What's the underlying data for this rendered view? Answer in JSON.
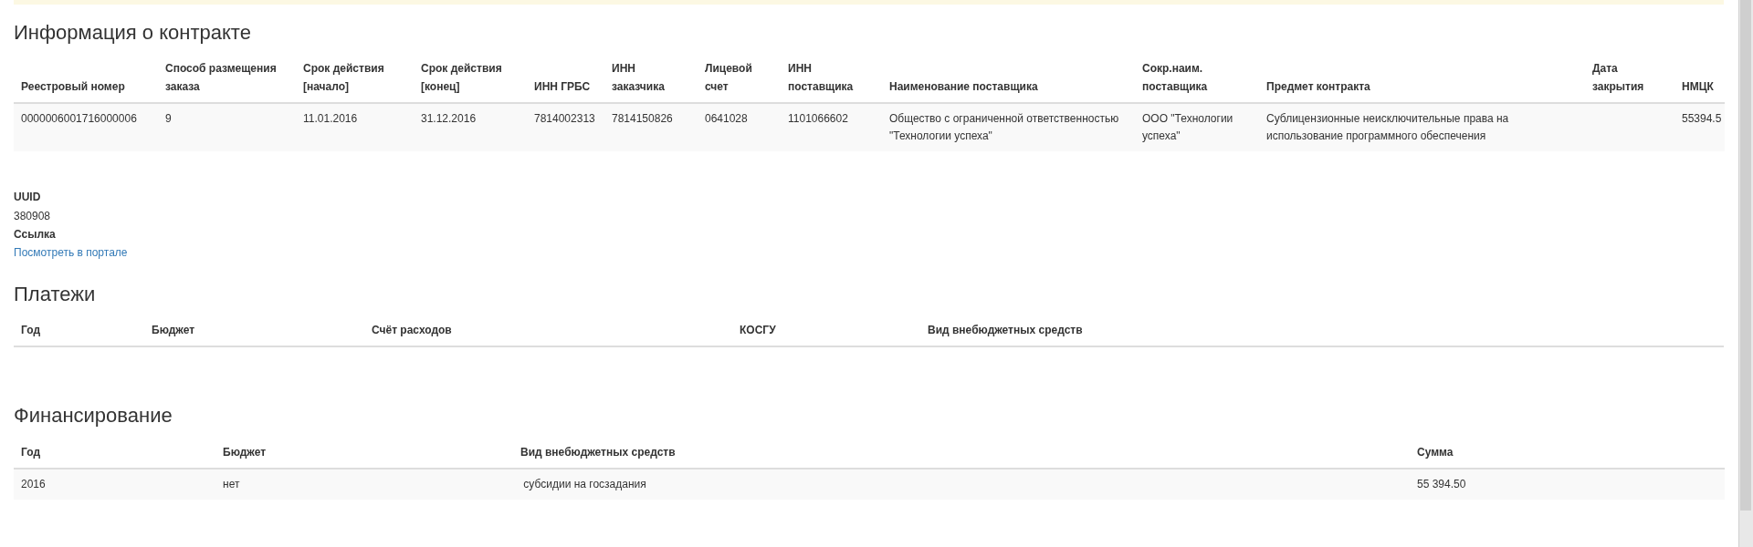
{
  "contract": {
    "title": "Информация о контракте",
    "columns": [
      "Реестровый номер",
      "Способ размещения заказа",
      "Срок действия [начало]",
      "Срок действия [конец]",
      "ИНН ГРБС",
      "ИНН заказчика",
      "Лицевой счет",
      "ИНН поставщика",
      "Наименование поставщика",
      "Сокр.наим. поставщика",
      "Предмет контракта",
      "Дата закрытия",
      "НМЦК"
    ],
    "rows": [
      [
        "0000006001716000006",
        "9",
        "11.01.2016",
        "31.12.2016",
        "7814002313",
        "7814150826",
        "0641028",
        "1101066602",
        "Общество с ограниченной ответственностью \"Технологии успеха\"",
        "ООО \"Технологии успеха\"",
        "Сублицензионные неисключительные права на использование программного обеспечения",
        "",
        "55394.5"
      ]
    ]
  },
  "details": [
    {
      "label": "UUID",
      "value": "380908",
      "kind": "text"
    },
    {
      "label": "Ссылка",
      "value": "Посмотреть в портале",
      "kind": "link"
    }
  ],
  "payments": {
    "title": "Платежи",
    "columns": [
      "Год",
      "Бюджет",
      "Счёт расходов",
      "КОСГУ",
      "Вид внебюджетных средств"
    ]
  },
  "financing": {
    "title": "Финансирование",
    "columns": [
      "Год",
      "Бюджет",
      "Вид внебюджетных средств",
      "Сумма"
    ],
    "rows": [
      [
        "2016",
        "нет",
        " субсидии на госзадания",
        "55 394.50"
      ]
    ]
  }
}
